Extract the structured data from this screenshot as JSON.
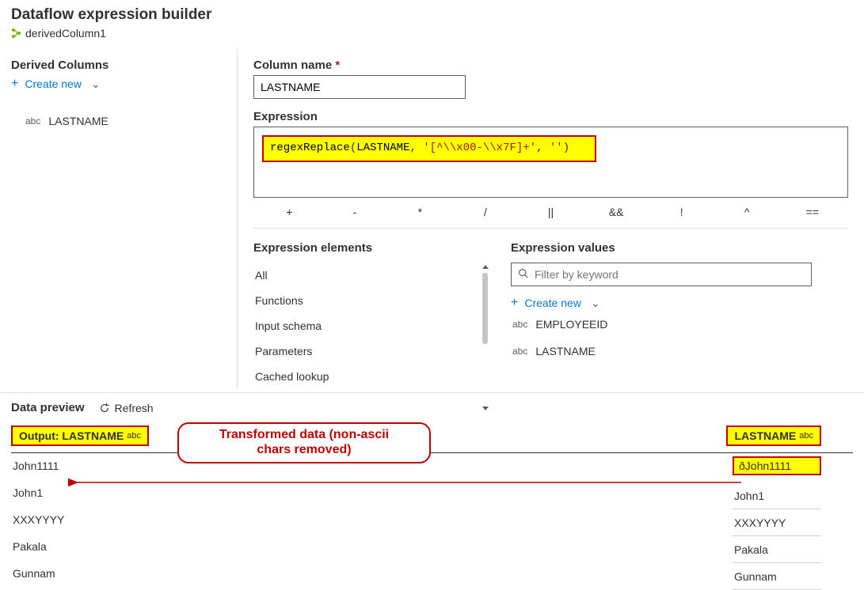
{
  "header": {
    "title": "Dataflow expression builder",
    "node_name": "derivedColumn1"
  },
  "left": {
    "section_title": "Derived Columns",
    "create_new": "Create new",
    "columns": [
      {
        "type": "abc",
        "name": "LASTNAME"
      }
    ]
  },
  "form": {
    "column_name_label": "Column name",
    "column_name_value": "LASTNAME",
    "expression_label": "Expression",
    "expression_parts": {
      "fn": "regexReplace",
      "arg": "LASTNAME",
      "str1": "'[^\\\\x00-\\\\x7F]+'",
      "str2": "''"
    }
  },
  "operators": [
    "+",
    "-",
    "*",
    "/",
    "||",
    "&&",
    "!",
    "^",
    "=="
  ],
  "elements": {
    "title": "Expression elements",
    "items": [
      "All",
      "Functions",
      "Input schema",
      "Parameters",
      "Cached lookup"
    ]
  },
  "values": {
    "title": "Expression values",
    "filter_placeholder": "Filter by keyword",
    "create_new": "Create new",
    "items": [
      {
        "type": "abc",
        "name": "EMPLOYEEID"
      },
      {
        "type": "abc",
        "name": "LASTNAME"
      }
    ]
  },
  "preview": {
    "title": "Data preview",
    "refresh": "Refresh",
    "annotation": "Transformed data (non-ascii chars removed)",
    "output_header": "Output: LASTNAME",
    "input_header": "LASTNAME",
    "rows": [
      {
        "out": "John1111",
        "in": "ðJohn1111",
        "highlight_in": true
      },
      {
        "out": "John1",
        "in": "John1"
      },
      {
        "out": "XXXYYYY",
        "in": "XXXYYYY"
      },
      {
        "out": "Pakala",
        "in": "Pakala"
      },
      {
        "out": "Gunnam",
        "in": "Gunnam"
      }
    ]
  }
}
